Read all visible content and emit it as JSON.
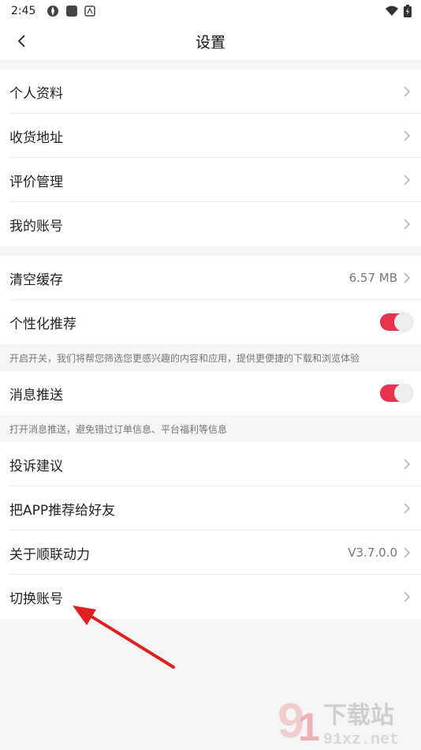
{
  "status_bar": {
    "time": "2:45"
  },
  "header": {
    "title": "设置"
  },
  "group1": [
    {
      "label": "个人资料"
    },
    {
      "label": "收货地址"
    },
    {
      "label": "评价管理"
    },
    {
      "label": "我的账号"
    }
  ],
  "group2": {
    "clear_cache": {
      "label": "清空缓存",
      "value": "6.57 MB"
    },
    "personalized": {
      "label": "个性化推荐",
      "on": true
    },
    "personalized_hint": "开启开关，我们将帮您筛选您更感兴趣的内容和应用，提供更便捷的下载和浏览体验"
  },
  "group3": {
    "push": {
      "label": "消息推送",
      "on": true
    },
    "push_hint": "打开消息推送，避免错过订单信息、平台福利等信息"
  },
  "group4": [
    {
      "label": "投诉建议"
    },
    {
      "label": "把APP推荐给好友"
    },
    {
      "label": "关于顺联动力",
      "value": "V3.7.0.0"
    },
    {
      "label": "切换账号"
    }
  ],
  "watermark": {
    "brand": "下载站",
    "site": "91xz.net"
  },
  "colors": {
    "toggle_on": "#e8334c",
    "arrow": "#e02020",
    "background": "#f5f5f5"
  }
}
